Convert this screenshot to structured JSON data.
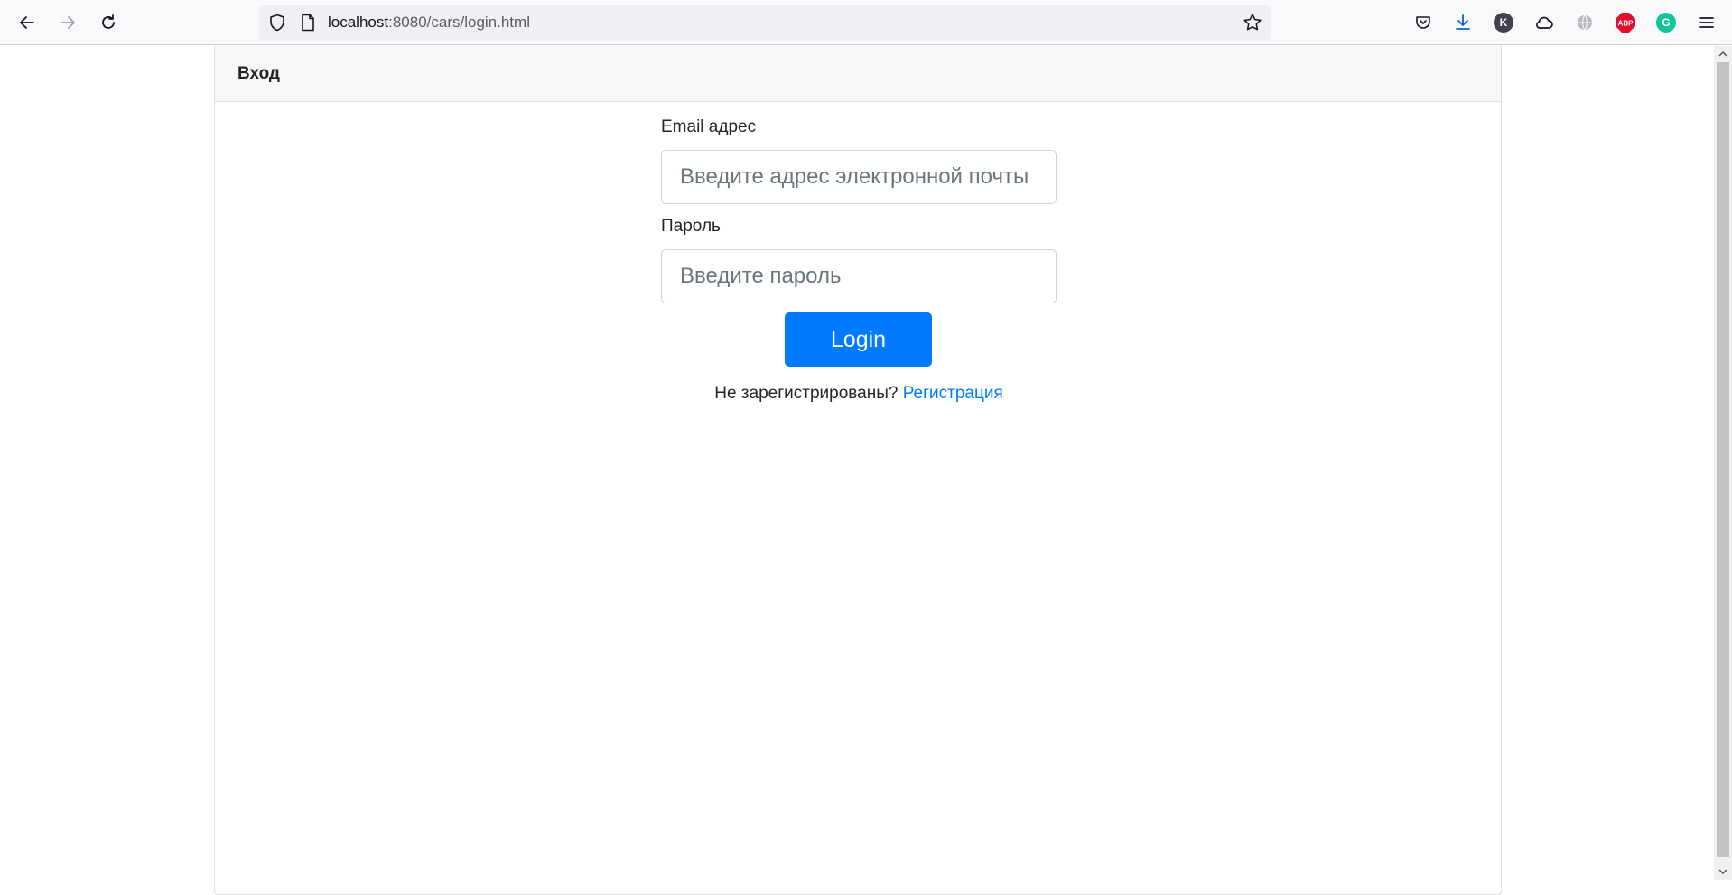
{
  "browser": {
    "url_host": "localhost",
    "url_rest": ":8080/cars/login.html"
  },
  "extensions": {
    "k_letter": "K",
    "abp_label": "ABP",
    "grammarly_letter": "G"
  },
  "page": {
    "card_title": "Вход",
    "email_label": "Email адрес",
    "email_placeholder": "Введите адрес электронной почты",
    "password_label": "Пароль",
    "password_placeholder": "Введите пароль",
    "login_button": "Login",
    "register_prompt": "Не зарегистрированы?",
    "register_link": "Регистрация"
  },
  "colors": {
    "accent": "#007bff",
    "abp_red": "#e40d2e",
    "grammarly_green": "#15c39a"
  }
}
